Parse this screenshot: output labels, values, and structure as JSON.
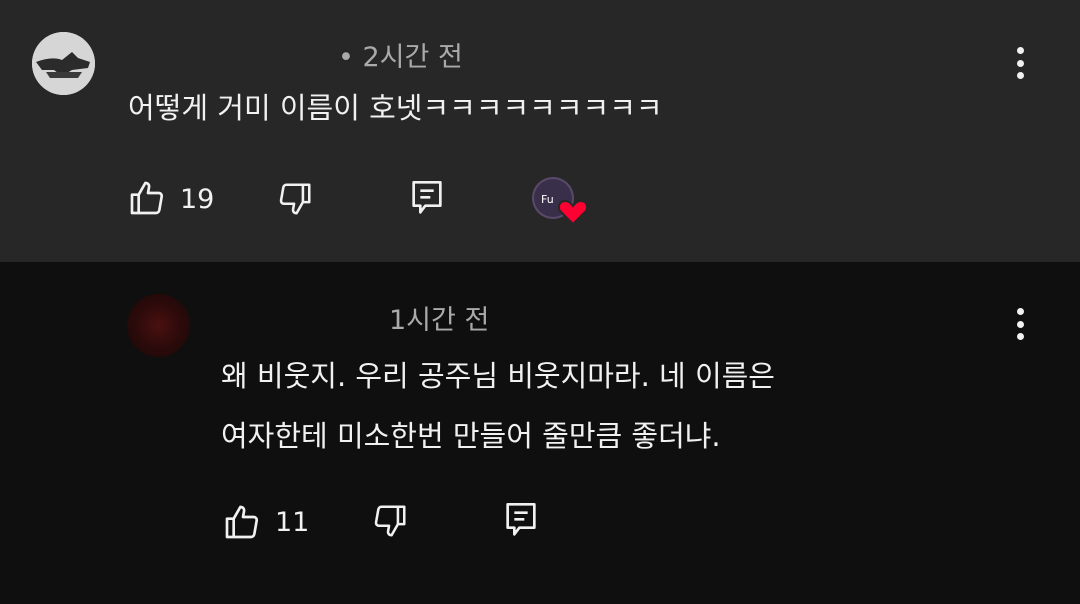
{
  "comments": [
    {
      "time": "• 2시간 전",
      "text": "어떻게 거미 이름이 호넷ㅋㅋㅋㅋㅋㅋㅋㅋㅋ",
      "likes": "19",
      "icons": {
        "like": "thumbs-up-icon",
        "dislike": "thumbs-down-icon",
        "reply": "reply-icon",
        "menu": "more-vert-icon",
        "hearted": "creator-heart-icon"
      }
    },
    {
      "time": "1시간 전",
      "text_lines": [
        "왜 비웃지. 우리 공주님 비웃지마라. 네 이름은",
        "여자한테 미소한번 만들어 줄만큼 좋더냐."
      ],
      "likes": "11",
      "icons": {
        "like": "thumbs-up-icon",
        "dislike": "thumbs-down-icon",
        "reply": "reply-icon",
        "menu": "more-vert-icon"
      }
    }
  ],
  "colors": {
    "top_bg": "#272727",
    "bottom_bg": "#0f0f0f",
    "text": "#f1f1f1",
    "meta": "#aaaaaa",
    "heart": "#ff0033"
  }
}
